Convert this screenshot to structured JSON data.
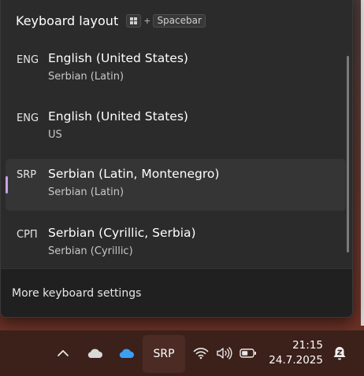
{
  "flyout": {
    "title": "Keyboard layout",
    "shortcut": {
      "plus": "+",
      "key": "Spacebar"
    },
    "languages": [
      {
        "abbr": "ENG",
        "name": "English (United States)",
        "layout": "Serbian (Latin)",
        "selected": false
      },
      {
        "abbr": "ENG",
        "name": "English (United States)",
        "layout": "US",
        "selected": false
      },
      {
        "abbr": "SRP",
        "name": "Serbian (Latin, Montenegro)",
        "layout": "Serbian (Latin)",
        "selected": true
      },
      {
        "abbr": "СРП",
        "name": "Serbian (Cyrillic, Serbia)",
        "layout": "Serbian (Cyrillic)",
        "selected": false
      }
    ],
    "footer_link": "More keyboard settings"
  },
  "taskbar": {
    "icons": [
      "chevron-up-icon",
      "cloud-icon",
      "onedrive-icon",
      "wifi-icon",
      "volume-icon",
      "battery-icon",
      "notification-icon"
    ],
    "input_indicator": "SRP",
    "time": "21:15",
    "date": "24.7.2025"
  },
  "colors": {
    "flyout_bg": "#2b2b2b",
    "selected_bg": "#353535",
    "accent": "#c8a2e8",
    "onedrive": "#3aa0f3",
    "taskbar_bg": "#3c201a"
  }
}
